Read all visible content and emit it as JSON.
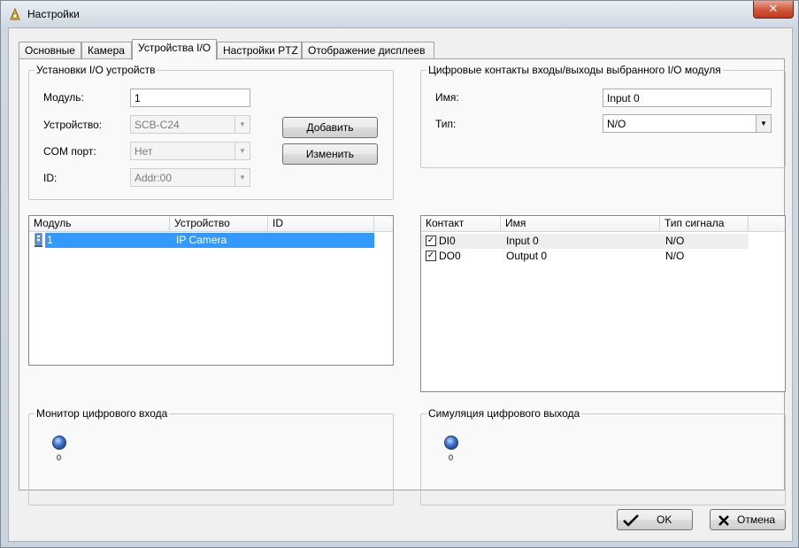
{
  "window": {
    "title": "Настройки",
    "close_glyph": "✕"
  },
  "tabs": [
    {
      "label": "Основные",
      "active": false
    },
    {
      "label": "Камера",
      "active": false
    },
    {
      "label": "Устройства I/O",
      "active": true
    },
    {
      "label": "Настройки PTZ",
      "active": false
    },
    {
      "label": "Отображение дисплеев",
      "active": false
    }
  ],
  "io_setup": {
    "legend": "Установки I/O устройств",
    "module_label": "Модуль:",
    "module_value": "1",
    "device_label": "Устройство:",
    "device_value": "SCB-C24",
    "com_label": "COM порт:",
    "com_value": "Нет",
    "id_label": "ID:",
    "id_value": "Addr:00",
    "add_button": "Добавить",
    "edit_button": "Изменить"
  },
  "module_list": {
    "columns": [
      "Модуль",
      "Устройство",
      "ID"
    ],
    "rows": [
      {
        "module": "1",
        "device": "IP Camera",
        "id": ""
      }
    ]
  },
  "digital_contacts": {
    "legend": "Цифровые контакты входы/выходы  выбранного I/O модуля",
    "name_label": "Имя:",
    "name_value": "Input 0",
    "type_label": "Тип:",
    "type_value": "N/O"
  },
  "contact_list": {
    "columns": [
      "Контакт",
      "Имя",
      "Тип сигнала"
    ],
    "rows": [
      {
        "contact": "DI0",
        "name": "Input 0",
        "signal": "N/O",
        "checked": true
      },
      {
        "contact": "DO0",
        "name": "Output 0",
        "signal": "N/O",
        "checked": true
      }
    ]
  },
  "input_monitor": {
    "legend": "Монитор цифрового входа",
    "led_label": "0"
  },
  "output_sim": {
    "legend": "Симуляция цифрового выхода",
    "led_label": "0"
  },
  "footer": {
    "ok_label": "OK",
    "cancel_label": "Отмена"
  },
  "colors": {
    "selection": "#3399ff",
    "close_button": "#c2361a"
  }
}
